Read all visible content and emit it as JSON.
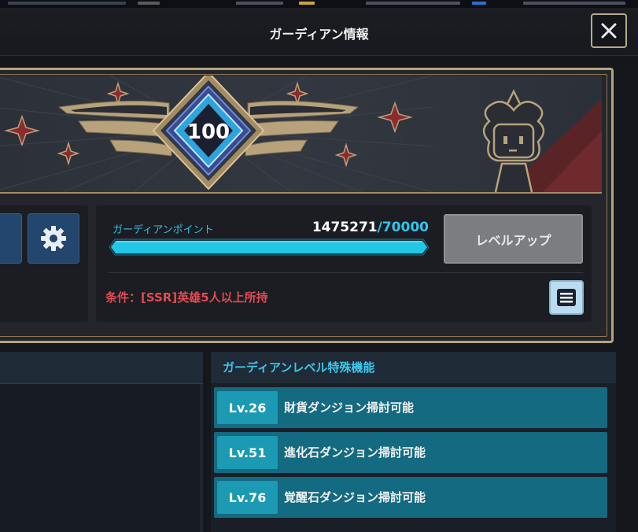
{
  "window": {
    "title": "ガーディアン情報"
  },
  "guardian": {
    "level": "100",
    "points_label": "ガーディアンポイント",
    "points_current": "1475271",
    "points_sep": "/",
    "points_required": "70000",
    "progress_fraction": 1.0,
    "condition": "条件：[SSR]英雄5人以上所持"
  },
  "buttons": {
    "level_up": "レベルアップ"
  },
  "features": {
    "title": "ガーディアンレベル特殊機能",
    "items": [
      {
        "level": "Lv.26",
        "text": "財貨ダンジョン掃討可能"
      },
      {
        "level": "Lv.51",
        "text": "進化石ダンジョン掃討可能"
      },
      {
        "level": "Lv.76",
        "text": "覚醒石ダンジョン掃討可能"
      }
    ]
  },
  "icons": {
    "close": "close-icon",
    "gear": "gear-icon",
    "menu": "menu-icon"
  },
  "colors": {
    "accent_cyan": "#2fc6ee",
    "condition_red": "#e04b52",
    "frame_gold": "#b7a27c",
    "feature_row": "#146a80",
    "feature_badge": "#1c99b3",
    "level_button_gray": "#7b7d80"
  }
}
